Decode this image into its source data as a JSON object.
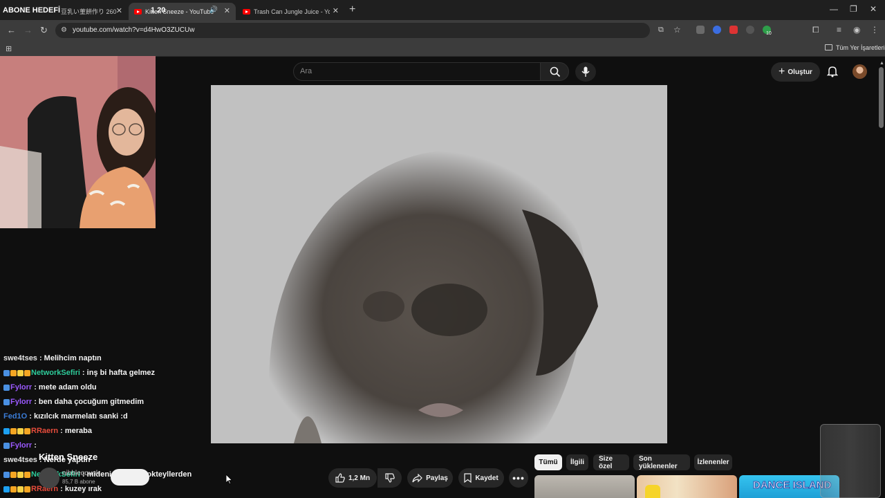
{
  "browser": {
    "tabs": [
      {
        "label": "豆乳い菫餅作り 260",
        "active": false
      },
      {
        "label": "Kitten Sneeze - YouTube",
        "active": true
      },
      {
        "label": "Trash Can Jungle Juice - YouTu",
        "active": false
      }
    ],
    "url": "youtube.com/watch?v=d4HwO3ZUCUw",
    "bookmarks_all": "Tüm Yer İşaretleri",
    "extension_badge": "10"
  },
  "overlay": {
    "subscriber_goal_label": "ABONE HEDEFİ",
    "subscriber_goal_value": "1 20",
    "progress_fraction": 0.02
  },
  "youtube": {
    "search_placeholder": "Ara",
    "create_label": "Oluştur",
    "video_title": "Kitten Sneeze",
    "channel_name": "nibbleqqunk",
    "channel_subs": "85,7 B abone",
    "actions": {
      "like_count": "1,2 Mn",
      "share": "Paylaş",
      "save": "Kaydet"
    },
    "chips": [
      "Tümü",
      "İlgili",
      "Size özel",
      "Son yüklenenler",
      "İzlenenler"
    ],
    "thumb3_text": "DANCE ISLAND"
  },
  "chat": [
    {
      "user": "swe4tses",
      "message": ": Melihcim naptın",
      "color": "#e6e6e6",
      "badges": []
    },
    {
      "user": "NetworkSefiri",
      "message": ": inş bi hafta gelmez",
      "color": "#2ecc9a",
      "badges": [
        "#4a90e2",
        "#f5a623",
        "#f8d347",
        "#f5a623"
      ]
    },
    {
      "user": "Fylorr",
      "message": ": mete adam oldu",
      "color": "#9b59ff",
      "badges": [
        "#4a90e2"
      ]
    },
    {
      "user": "Fylorr",
      "message": ": ben daha çocuğum gitmedim",
      "color": "#9b59ff",
      "badges": [
        "#4a90e2"
      ]
    },
    {
      "user": "Fed1O",
      "message": ": kızılcık marmelatı sanki :d",
      "color": "#3b7dd8",
      "badges": []
    },
    {
      "user": "RRaern",
      "message": ": meraba",
      "color": "#e74c3c",
      "badges": [
        "#1da1f2",
        "#f5a623",
        "#f8d347",
        "#f5a623"
      ]
    },
    {
      "user": "Fylorr",
      "message": ":",
      "color": "#9b59ff",
      "badges": [
        "#4a90e2"
      ]
    },
    {
      "user": "swe4tses",
      "message": ": Nerde yaptın",
      "color": "#e6e6e6",
      "badges": []
    },
    {
      "user": "NetworkSefiri",
      "message": ": mideni bulandı kokteyllerden",
      "color": "#2ecc9a",
      "badges": [
        "#4a90e2",
        "#f5a623",
        "#f8d347",
        "#f5a623"
      ]
    },
    {
      "user": "RRaern",
      "message": ": kuzey ırak",
      "color": "#e74c3c",
      "badges": [
        "#1da1f2",
        "#f5a623",
        "#f8d347",
        "#f5a623"
      ]
    }
  ]
}
